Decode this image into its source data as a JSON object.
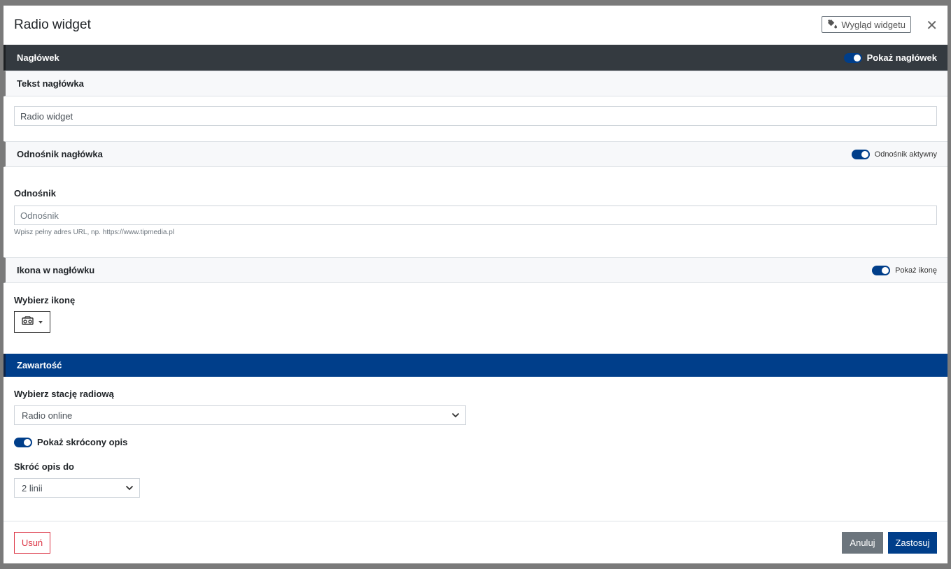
{
  "modal": {
    "title": "Radio widget",
    "appearance_button": "Wygląd widgetu",
    "appearance_icon": "paint-bucket-icon",
    "close_icon": "close-icon",
    "close_glyph": "✕"
  },
  "header_section": {
    "title": "Nagłówek",
    "toggle_label": "Pokaż nagłówek",
    "toggle_on": true
  },
  "header_text": {
    "title": "Tekst nagłówka",
    "value": "Radio widget"
  },
  "header_link": {
    "title": "Odnośnik nagłówka",
    "toggle_label": "Odnośnik aktywny",
    "toggle_on": true,
    "field_label": "Odnośnik",
    "placeholder": "Odnośnik",
    "value": "",
    "hint": "Wpisz pełny adres URL, np. https://www.tipmedia.pl"
  },
  "header_icon": {
    "title": "Ikona w nagłówku",
    "toggle_label": "Pokaż ikonę",
    "toggle_on": true,
    "field_label": "Wybierz ikonę",
    "selected_icon": "radio-icon"
  },
  "content_section": {
    "title": "Zawartość",
    "station_label": "Wybierz stację radiową",
    "station_value": "Radio online",
    "short_desc_toggle_label": "Pokaż skrócony opis",
    "short_desc_toggle_on": true,
    "shorten_label": "Skróć opis do",
    "shorten_value": "2 linii"
  },
  "footer": {
    "delete_label": "Usuń",
    "cancel_label": "Anuluj",
    "apply_label": "Zastosuj"
  },
  "colors": {
    "primary": "#003e8a",
    "dark_header": "#343a40",
    "danger": "#dc3545",
    "secondary": "#6c757d"
  }
}
